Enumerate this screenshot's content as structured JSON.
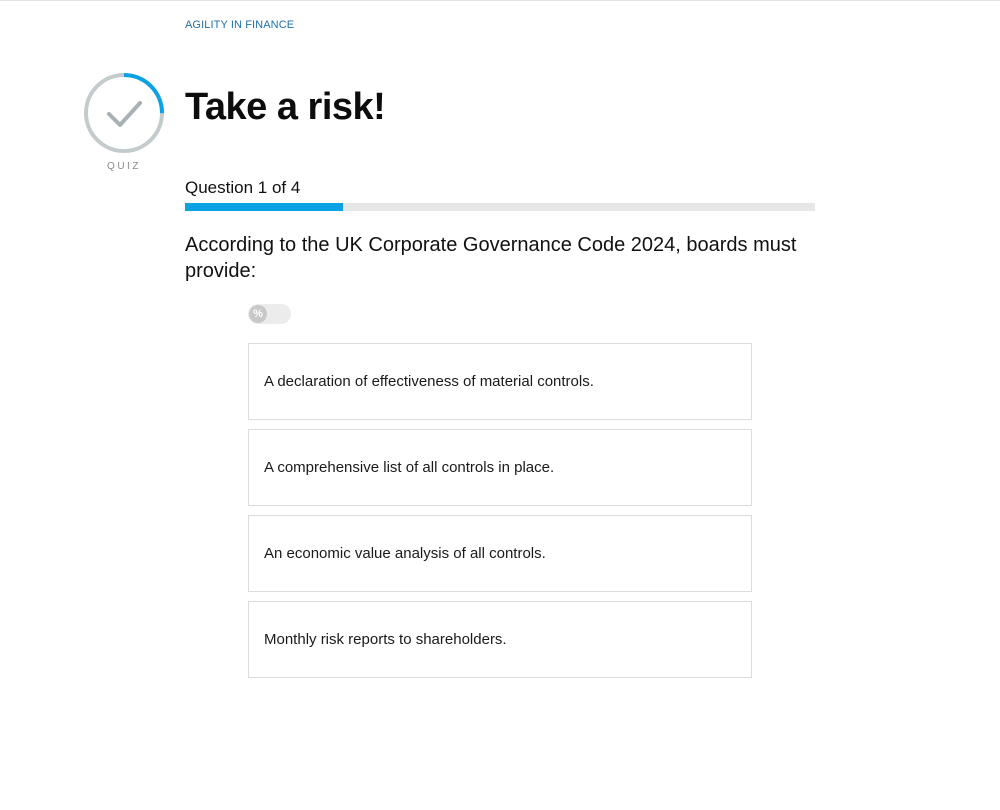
{
  "header": {
    "breadcrumb": "AGILITY IN FINANCE"
  },
  "quiz_badge": {
    "label": "QUIZ",
    "icon": "checkmark-icon",
    "ring_color": "#c4cbcd",
    "accent_color": "#0aa2e3",
    "ring_progress": 0.25
  },
  "title": "Take a risk!",
  "progress": {
    "label": "Question 1 of 4",
    "current": 1,
    "total": 4,
    "fraction": 0.25,
    "fill_color": "#0aa2e3"
  },
  "question": {
    "text": "According to the UK Corporate Governance Code 2024, boards must provide:"
  },
  "percent_toggle": {
    "symbol": "%",
    "on": false
  },
  "answers": [
    {
      "label": "A declaration of effectiveness of material controls."
    },
    {
      "label": "A comprehensive list of all controls in place."
    },
    {
      "label": "An economic value analysis of all controls."
    },
    {
      "label": "Monthly risk reports to shareholders."
    }
  ]
}
